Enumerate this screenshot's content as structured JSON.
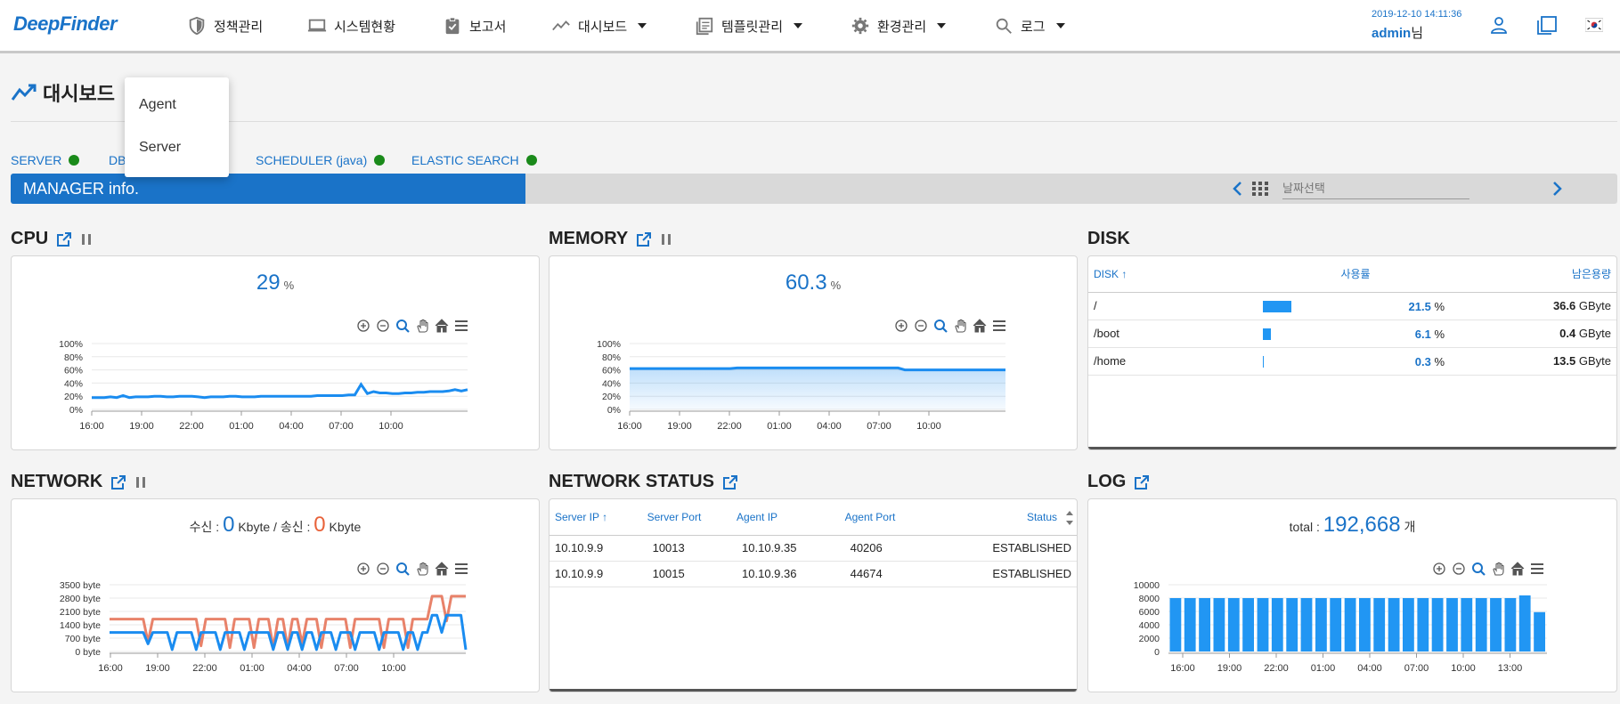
{
  "header": {
    "logo": "DeepFinder",
    "nav": [
      {
        "label": "정책관리",
        "icon": "shield-icon"
      },
      {
        "label": "시스템현황",
        "icon": "monitor-icon"
      },
      {
        "label": "보고서",
        "icon": "clipboard-check-icon"
      },
      {
        "label": "대시보드",
        "icon": "trend-icon",
        "dropdown": true
      },
      {
        "label": "템플릿관리",
        "icon": "template-icon",
        "dropdown": true
      },
      {
        "label": "환경관리",
        "icon": "gear-icon",
        "dropdown": true
      },
      {
        "label": "로그",
        "icon": "search-icon",
        "dropdown": true
      }
    ],
    "datetime": "2019-12-10 14:11:36",
    "user": "admin",
    "user_suffix": "님"
  },
  "page": {
    "title": "대시보드"
  },
  "dropdown": {
    "items": [
      "Agent",
      "Server"
    ]
  },
  "status": [
    {
      "label": "SERVER",
      "color": "#1a8a1a"
    },
    {
      "label": "DB",
      "color": "#1a8a1a"
    },
    {
      "label": "SCHEDULER (java)",
      "color": "#1a8a1a"
    },
    {
      "label": "ELASTIC SEARCH",
      "color": "#1a8a1a"
    }
  ],
  "manager": {
    "label": "MANAGER info.",
    "date_placeholder": "날짜선택"
  },
  "cpu": {
    "title": "CPU",
    "value": "29",
    "unit": "%",
    "chart_data": {
      "type": "line",
      "y_ticks": [
        "100%",
        "80%",
        "60%",
        "40%",
        "20%",
        "0%"
      ],
      "x_ticks": [
        "16:00",
        "19:00",
        "22:00",
        "01:00",
        "04:00",
        "07:00",
        "10:00"
      ],
      "ylim": [
        0,
        100
      ],
      "values": [
        18,
        18,
        18,
        19,
        18,
        21,
        18,
        19,
        19,
        19,
        20,
        20,
        19,
        19,
        20,
        20,
        20,
        19,
        18,
        19,
        19,
        19,
        20,
        20,
        19,
        19,
        19,
        20,
        20,
        20,
        20,
        20,
        20,
        20,
        20,
        20,
        21,
        21,
        21,
        21,
        21,
        22,
        22,
        38,
        24,
        27,
        25,
        25,
        24,
        24,
        25,
        25,
        26,
        26,
        27,
        27,
        27,
        28,
        30,
        28,
        30
      ],
      "color": "#1a8cf0"
    }
  },
  "memory": {
    "title": "MEMORY",
    "value": "60.3",
    "unit": "%",
    "chart_data": {
      "type": "area",
      "y_ticks": [
        "100%",
        "80%",
        "60%",
        "40%",
        "20%",
        "0%"
      ],
      "x_ticks": [
        "16:00",
        "19:00",
        "22:00",
        "01:00",
        "04:00",
        "07:00",
        "10:00"
      ],
      "ylim": [
        0,
        100
      ],
      "values": [
        62,
        62,
        62,
        62,
        62,
        62,
        62,
        62,
        62,
        62,
        62,
        62,
        62,
        62,
        62,
        62,
        63,
        63,
        63,
        63,
        63,
        63,
        63,
        63,
        63,
        63,
        63,
        63,
        63,
        63,
        63,
        63,
        63,
        63,
        63,
        63,
        63,
        63,
        63,
        63,
        63,
        60,
        60,
        60,
        60,
        60,
        60,
        60,
        60,
        60,
        60,
        60,
        60,
        60,
        60,
        60,
        60
      ],
      "color": "#1a8cf0"
    }
  },
  "disk": {
    "title": "DISK",
    "columns": [
      "DISK",
      "사용률",
      "남은용량"
    ],
    "rows": [
      {
        "name": "/",
        "usage": "21.5",
        "usage_pct": 21.5,
        "free": "36.6",
        "free_unit": "GByte"
      },
      {
        "name": "/boot",
        "usage": "6.1",
        "usage_pct": 6.1,
        "free": "0.4",
        "free_unit": "GByte"
      },
      {
        "name": "/home",
        "usage": "0.3",
        "usage_pct": 0.3,
        "free": "13.5",
        "free_unit": "GByte"
      }
    ],
    "pct_unit": "%"
  },
  "network": {
    "title": "NETWORK",
    "recv_label": "수신 :",
    "recv_value": "0",
    "recv_unit": "Kbyte",
    "sep": "/ 송신 :",
    "send_value": "0",
    "send_unit": "Kbyte",
    "chart_data": {
      "type": "line",
      "y_ticks": [
        "3500 byte",
        "2800 byte",
        "2100 byte",
        "1400 byte",
        "700 byte",
        "0 byte"
      ],
      "x_ticks": [
        "16:00",
        "19:00",
        "22:00",
        "01:00",
        "04:00",
        "07:00",
        "10:00"
      ],
      "ylim": [
        0,
        3500
      ],
      "series": [
        {
          "color": "#e8826a",
          "values": [
            1700,
            1700,
            1700,
            1700,
            1700,
            1700,
            1700,
            1700,
            500,
            1700,
            1700,
            1700,
            1700,
            1700,
            1700,
            1700,
            1700,
            1700,
            1700,
            300,
            1700,
            1700,
            1700,
            1700,
            1700,
            200,
            1700,
            1700,
            1700,
            1700,
            200,
            1700,
            1700,
            1700,
            200,
            1700,
            1700,
            200,
            1700,
            1700,
            400,
            1700,
            1700,
            1700,
            200,
            1700,
            1700,
            1700,
            1700,
            1700,
            200,
            1700,
            1700,
            1700,
            1700,
            1700,
            1700,
            200,
            1700,
            1700,
            1700,
            1700,
            200,
            1700,
            1700,
            1700,
            1700,
            2900,
            2900,
            2900,
            1600,
            2900,
            2900,
            2900,
            2900
          ]
        },
        {
          "color": "#1a8cf0",
          "values": [
            1000,
            1000,
            1000,
            1000,
            1000,
            1000,
            1000,
            1000,
            400,
            1000,
            1000,
            1000,
            1000,
            100,
            1000,
            1000,
            1000,
            1000,
            100,
            1000,
            1000,
            1000,
            1000,
            100,
            1000,
            1000,
            1000,
            1000,
            100,
            1000,
            1000,
            1000,
            1000,
            1000,
            100,
            1000,
            1000,
            100,
            1000,
            1000,
            100,
            1000,
            1000,
            100,
            1000,
            1000,
            1000,
            100,
            1000,
            1000,
            1000,
            100,
            1000,
            1000,
            1000,
            1000,
            100,
            1000,
            1000,
            1000,
            1000,
            100,
            1000,
            1000,
            100,
            1000,
            1000,
            1900,
            1900,
            1000,
            1900,
            1900,
            1900,
            1900,
            100
          ]
        }
      ]
    }
  },
  "network_status": {
    "title": "NETWORK STATUS",
    "columns": [
      "Server IP",
      "Server Port",
      "Agent IP",
      "Agent Port",
      "Status"
    ],
    "rows": [
      [
        "10.10.9.9",
        "10013",
        "10.10.9.35",
        "40206",
        "ESTABLISHED"
      ],
      [
        "10.10.9.9",
        "10015",
        "10.10.9.36",
        "44674",
        "ESTABLISHED"
      ]
    ]
  },
  "log": {
    "title": "LOG",
    "total_label": "total :",
    "total_value": "192,668",
    "total_unit": "개",
    "chart_data": {
      "type": "bar",
      "y_ticks": [
        "10000",
        "8000",
        "6000",
        "4000",
        "2000",
        "0"
      ],
      "x_ticks": [
        "16:00",
        "19:00",
        "22:00",
        "01:00",
        "04:00",
        "07:00",
        "10:00",
        "13:00"
      ],
      "ylim": [
        0,
        10000
      ],
      "values": [
        8000,
        8000,
        8000,
        8000,
        8000,
        8000,
        8000,
        8000,
        8000,
        8000,
        8000,
        8000,
        8000,
        8000,
        8000,
        8000,
        8000,
        8000,
        8000,
        8000,
        8000,
        8000,
        8000,
        8000,
        8400,
        5900
      ],
      "color": "#2196f3"
    }
  }
}
